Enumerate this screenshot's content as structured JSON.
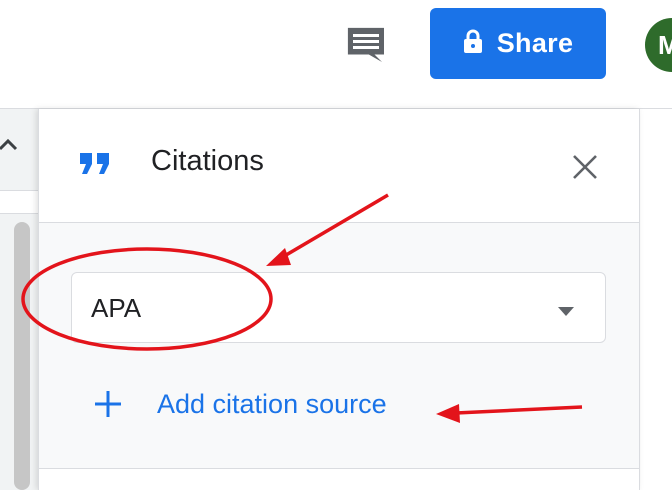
{
  "header": {
    "share_label": "Share",
    "avatar_initial": "M",
    "icons": {
      "comment": "comment-icon",
      "lock": "lock-icon"
    }
  },
  "citations_panel": {
    "title": "Citations",
    "icons": {
      "quote": "quote-icon",
      "close": "close-icon",
      "dropdown": "chevron-down-icon",
      "add": "plus-icon"
    },
    "style_select": {
      "selected": "APA"
    },
    "add_source_label": "Add citation source"
  },
  "colors": {
    "accent": "#1a73e8",
    "avatar": "#2e6b2b",
    "annotation": "#e3141b"
  }
}
